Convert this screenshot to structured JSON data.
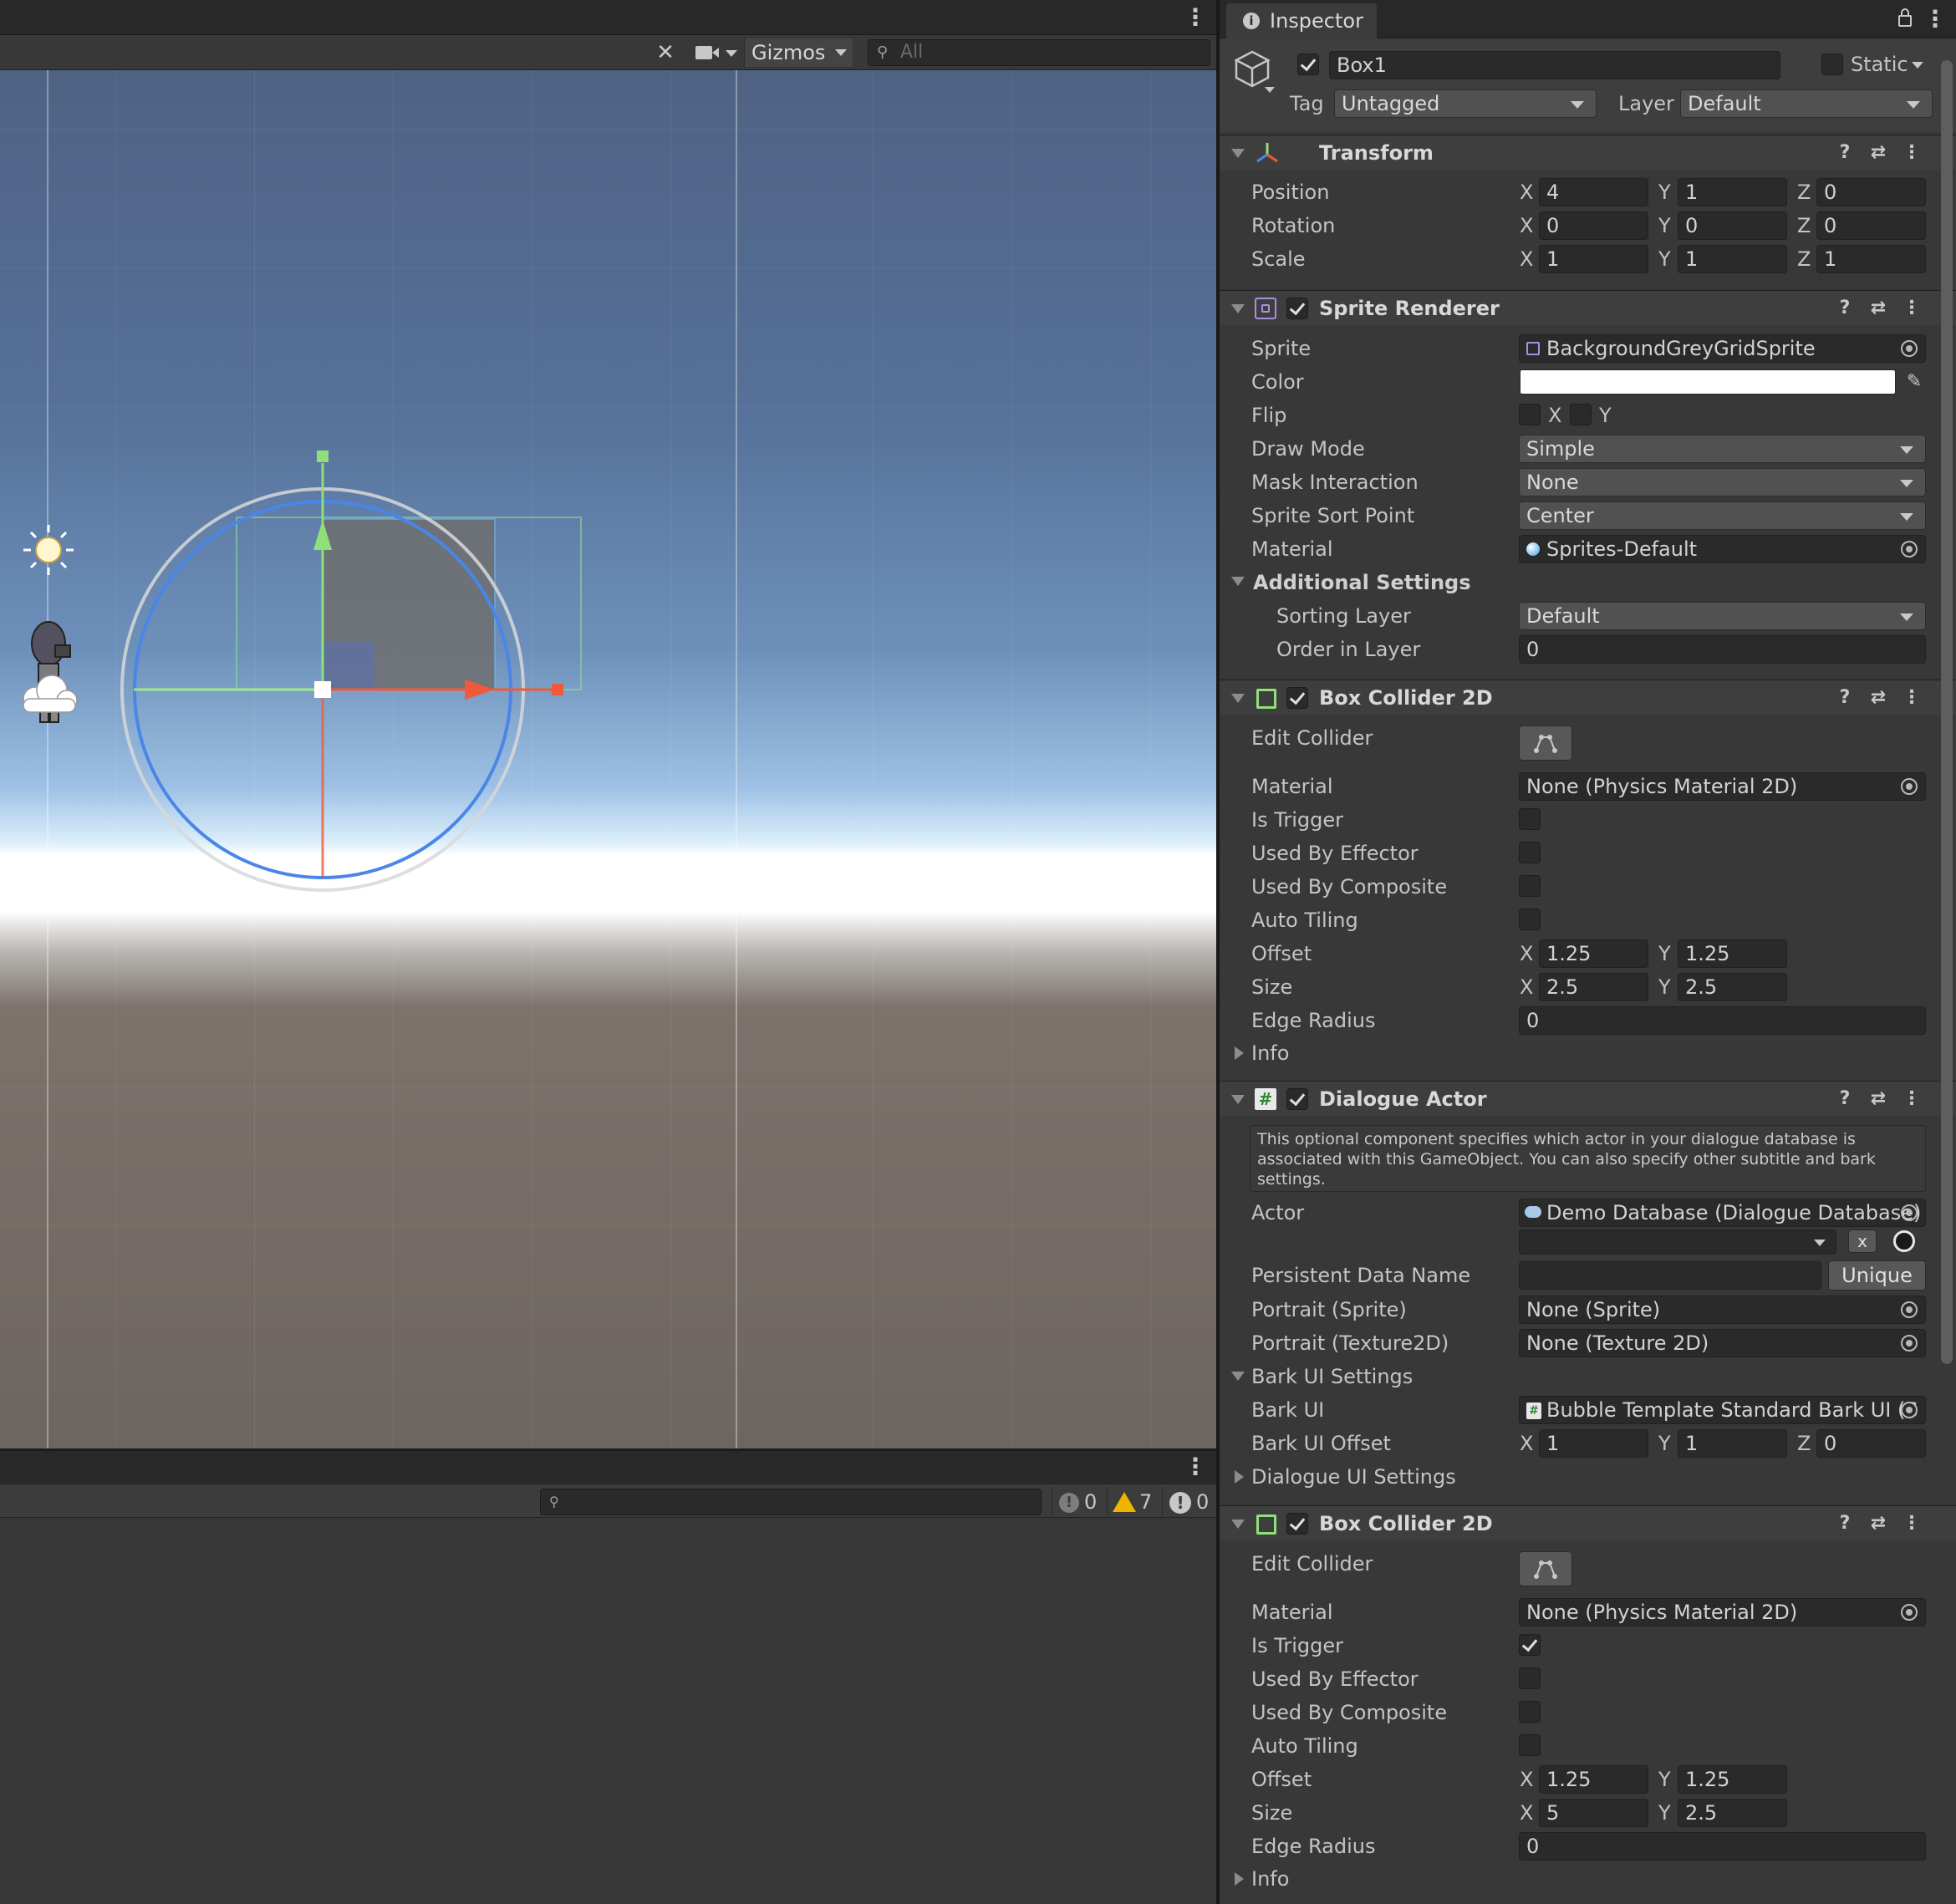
{
  "scene": {
    "gizmos_label": "Gizmos",
    "search_placeholder": "All"
  },
  "console": {
    "search_placeholder": "",
    "info_count": "0",
    "warning_count": "7",
    "error_count": "0"
  },
  "inspector": {
    "tab_label": "Inspector",
    "object": {
      "name": "Box1",
      "static_label": "Static",
      "tag_label": "Tag",
      "tag_value": "Untagged",
      "layer_label": "Layer",
      "layer_value": "Default"
    },
    "transform": {
      "title": "Transform",
      "position_label": "Position",
      "rotation_label": "Rotation",
      "scale_label": "Scale",
      "x": "X",
      "y": "Y",
      "z": "Z",
      "position": [
        "4",
        "1",
        "0"
      ],
      "rotation": [
        "0",
        "0",
        "0"
      ],
      "scale": [
        "1",
        "1",
        "1"
      ]
    },
    "sprite_renderer": {
      "title": "Sprite Renderer",
      "sprite_label": "Sprite",
      "sprite_value": "BackgroundGreyGridSprite",
      "color_label": "Color",
      "color_value": "#ffffff",
      "flip_label": "Flip",
      "flip_x": "X",
      "flip_y": "Y",
      "draw_mode_label": "Draw Mode",
      "draw_mode_value": "Simple",
      "mask_label": "Mask Interaction",
      "mask_value": "None",
      "sort_point_label": "Sprite Sort Point",
      "sort_point_value": "Center",
      "material_label": "Material",
      "material_value": "Sprites-Default",
      "additional_label": "Additional Settings",
      "sorting_layer_label": "Sorting Layer",
      "sorting_layer_value": "Default",
      "order_label": "Order in Layer",
      "order_value": "0"
    },
    "box_collider_1": {
      "title": "Box Collider 2D",
      "edit_label": "Edit Collider",
      "material_label": "Material",
      "material_value": "None (Physics Material 2D)",
      "trigger_label": "Is Trigger",
      "effector_label": "Used By Effector",
      "composite_label": "Used By Composite",
      "tiling_label": "Auto Tiling",
      "offset_label": "Offset",
      "offset": [
        "1.25",
        "1.25"
      ],
      "size_label": "Size",
      "size": [
        "2.5",
        "2.5"
      ],
      "edge_label": "Edge Radius",
      "edge_value": "0",
      "info_label": "Info"
    },
    "dialogue_actor": {
      "title": "Dialogue Actor",
      "help": "This optional component specifies which actor in your dialogue database is associated with this GameObject. You can also specify other subtitle and bark settings.",
      "actor_label": "Actor",
      "actor_db": "Demo Database (Dialogue Database)",
      "actor_clear": "x",
      "persistent_label": "Persistent Data Name",
      "unique_button": "Unique",
      "portrait_sprite_label": "Portrait (Sprite)",
      "portrait_sprite_value": "None (Sprite)",
      "portrait_tex_label": "Portrait (Texture2D)",
      "portrait_tex_value": "None (Texture 2D)",
      "bark_settings_label": "Bark UI Settings",
      "bark_ui_label": "Bark UI",
      "bark_ui_value": "Bubble Template Standard Bark UI (S",
      "bark_offset_label": "Bark UI Offset",
      "bark_offset": [
        "1",
        "1",
        "0"
      ],
      "dialogue_ui_label": "Dialogue UI Settings"
    },
    "box_collider_2": {
      "title": "Box Collider 2D",
      "edit_label": "Edit Collider",
      "material_label": "Material",
      "material_value": "None (Physics Material 2D)",
      "trigger_label": "Is Trigger",
      "effector_label": "Used By Effector",
      "composite_label": "Used By Composite",
      "tiling_label": "Auto Tiling",
      "offset_label": "Offset",
      "offset": [
        "1.25",
        "1.25"
      ],
      "size_label": "Size",
      "size": [
        "5",
        "2.5"
      ],
      "edge_label": "Edge Radius",
      "edge_value": "0",
      "info_label": "Info"
    }
  }
}
